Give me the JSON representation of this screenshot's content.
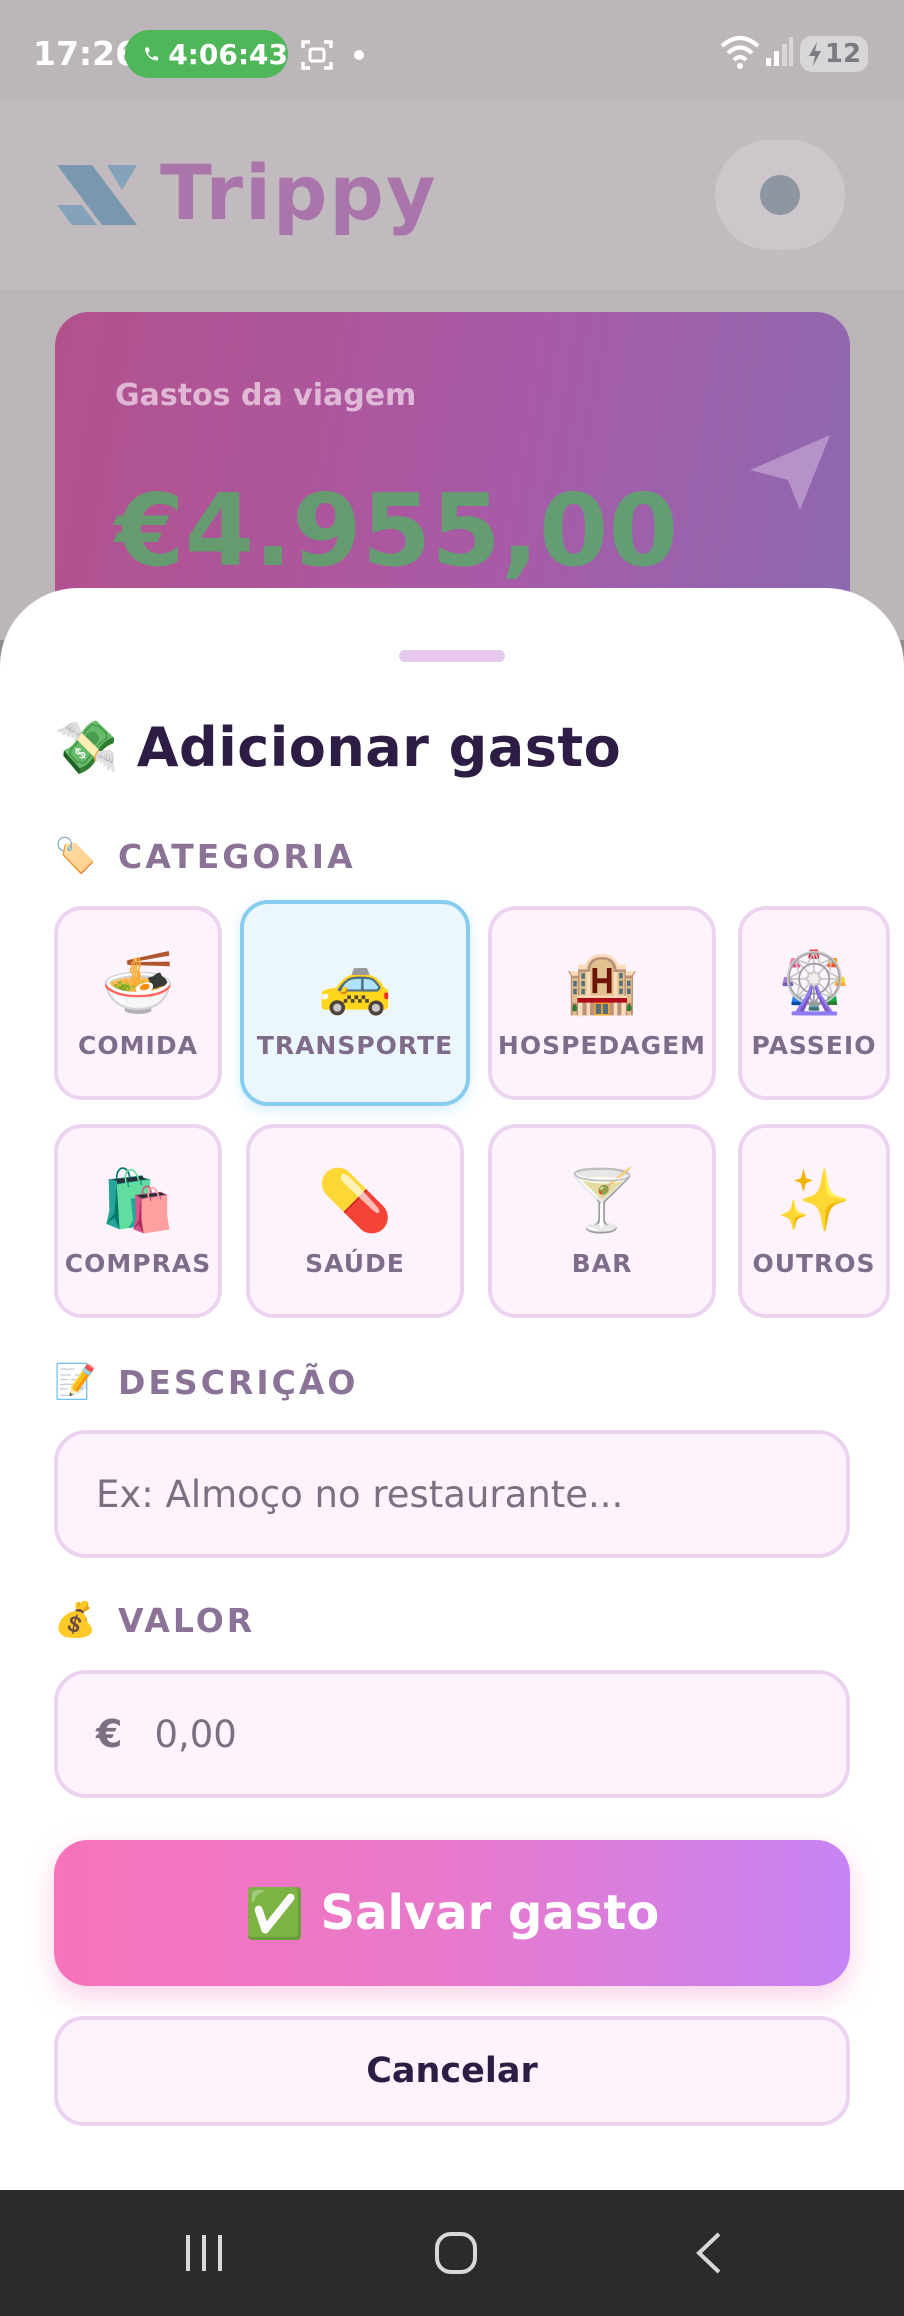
{
  "status_bar": {
    "time": "17:26",
    "call_timer": "4:06:43",
    "battery": "12"
  },
  "background": {
    "brand": "Trippy",
    "card_label": "Gastos da viagem",
    "card_dates": "",
    "card_amount": "€4.955,00"
  },
  "sheet": {
    "title_emoji": "💸",
    "title": "Adicionar gasto",
    "category_section": {
      "emoji": "🏷️",
      "label": "CATEGORIA"
    },
    "categories": [
      {
        "emoji": "🍜",
        "label": "COMIDA"
      },
      {
        "emoji": "🚕",
        "label": "TRANSPORTE"
      },
      {
        "emoji": "🏨",
        "label": "HOSPEDAGEM"
      },
      {
        "emoji": "🎡",
        "label": "PASSEIO"
      },
      {
        "emoji": "🛍️",
        "label": "COMPRAS"
      },
      {
        "emoji": "💊",
        "label": "SAÚDE"
      },
      {
        "emoji": "🍸",
        "label": "BAR"
      },
      {
        "emoji": "✨",
        "label": "OUTROS"
      }
    ],
    "selected_category": "TRANSPORTE",
    "description_section": {
      "emoji": "📝",
      "label": "DESCRIÇÃO"
    },
    "description_input": {
      "value": "",
      "placeholder": "Ex: Almoço no restaurante..."
    },
    "value_section": {
      "emoji": "💰",
      "label": "VALOR"
    },
    "value_input": {
      "currency": "€",
      "value": "",
      "placeholder": "0,00"
    },
    "save_button": {
      "emoji": "✅",
      "label": "Salvar gasto"
    },
    "cancel_button": {
      "label": "Cancelar"
    }
  },
  "colors": {
    "accent_pink": "#f773bb",
    "accent_purple": "#c684f4",
    "selected_border": "#87cdf0",
    "card_border": "#ecd4f0",
    "title_text": "#2d1d44",
    "label_text": "#8a7396"
  }
}
